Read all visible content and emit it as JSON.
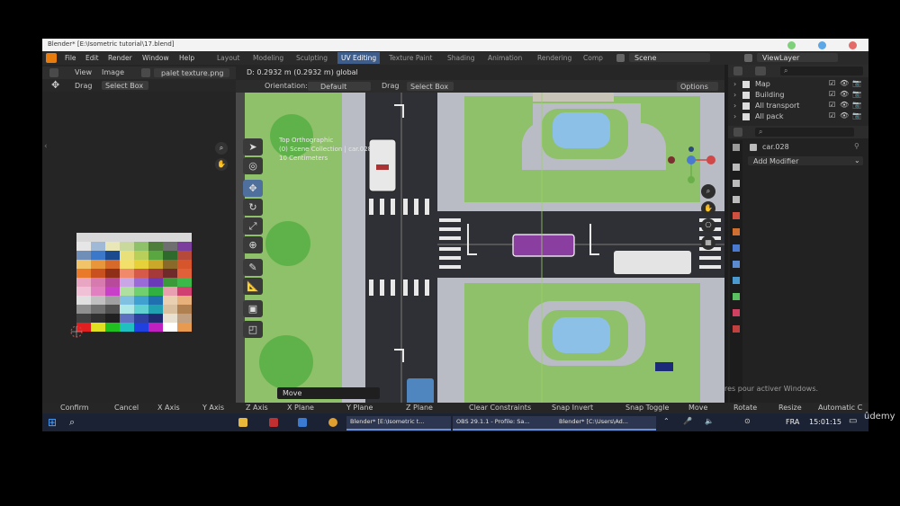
{
  "title_bar": {
    "text": "Blender* [E:\\Isometric tutorial\\17.blend]"
  },
  "menu": [
    "File",
    "Edit",
    "Render",
    "Window",
    "Help"
  ],
  "workspaces": [
    "Layout",
    "Modeling",
    "Sculpting",
    "UV Editing",
    "Texture Paint",
    "Shading",
    "Animation",
    "Rendering",
    "Comp"
  ],
  "active_workspace": "UV Editing",
  "scene_field": "Scene",
  "viewlayer_field": "ViewLayer",
  "uv_editor": {
    "view_menu": "View",
    "image_menu": "Image",
    "image_name": "palet texture.png",
    "drag_label": "Drag",
    "select_box": "Select Box"
  },
  "viewport": {
    "header_info": "D: 0.2932 m (0.2932 m) global",
    "orientation_label": "Orientation:",
    "orientation_value": "Default",
    "drag_label": "Drag",
    "select_box": "Select Box",
    "options_label": "Options",
    "overlay_text_1": "Top Orthographic",
    "overlay_text_2": "(0) Scene Collection | car.028",
    "overlay_text_3": "10 Centimeters",
    "operator_panel": "Move",
    "watermark": "res pour activer Windows."
  },
  "outliner": {
    "items": [
      {
        "label": "Map",
        "icon": "collection-icon"
      },
      {
        "label": "Building",
        "icon": "collection-icon"
      },
      {
        "label": "All transport",
        "icon": "collection-icon"
      },
      {
        "label": "All pack",
        "icon": "collection-icon"
      }
    ]
  },
  "properties": {
    "object_name": "car.028",
    "add_modifier": "Add Modifier"
  },
  "status_bar": [
    "Confirm",
    "Cancel",
    "X Axis",
    "Y Axis",
    "Z Axis",
    "X Plane",
    "Y Plane",
    "Z Plane",
    "Clear Constraints",
    "Snap Invert",
    "Snap Toggle",
    "Move",
    "Rotate",
    "Resize",
    "Automatic C"
  ],
  "taskbar": {
    "apps": [
      "Blender* [E:\\Isometric t...",
      "OBS 29.1.1 - Profile: Sa...",
      "Blender* [C:\\Users\\Ad..."
    ],
    "lang": "FRA",
    "time": "15:01:15"
  },
  "udemy_logo": "ûdemy",
  "colors": {
    "accent": "#4f6f9c",
    "grass": "#8fc06a",
    "road": "#2f3036",
    "sidewalk": "#b9bcc4",
    "water": "#8cc0e6",
    "selected_car": "#8a3fa0"
  }
}
